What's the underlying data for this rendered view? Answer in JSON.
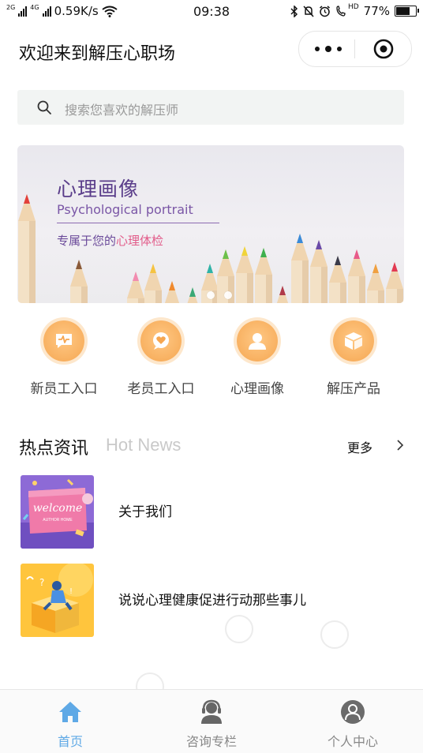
{
  "status_bar": {
    "network_left": "2G",
    "network_right": "4G",
    "speed": "0.59K/s",
    "time": "09:38",
    "hd_label": "HD",
    "battery_percent": "77%",
    "battery_level": 0.77
  },
  "header": {
    "title": "欢迎来到解压心职场"
  },
  "search": {
    "placeholder": "搜索您喜欢的解压师"
  },
  "banner": {
    "title": "心理画像",
    "subtitle": "Psychological portrait",
    "tag_prefix": "专属于您的",
    "tag_highlight": "心理体检",
    "slide_count": 2,
    "active_slide": 1
  },
  "shortcuts": [
    {
      "label": "新员工入口",
      "icon": "pulse-chat-icon"
    },
    {
      "label": "老员工入口",
      "icon": "heart-chat-icon"
    },
    {
      "label": "心理画像",
      "icon": "user-icon"
    },
    {
      "label": "解压产品",
      "icon": "box-icon"
    }
  ],
  "hot_news": {
    "title": "热点资讯",
    "title_en": "Hot News",
    "more_label": "更多",
    "items": [
      {
        "title": "关于我们",
        "thumb_text": "welcome",
        "thumb_subtext": "AUTHOR HOME"
      },
      {
        "title": "说说心理健康促进行动那些事儿"
      }
    ]
  },
  "tabbar": {
    "items": [
      {
        "label": "首页",
        "icon": "home-icon",
        "active": true
      },
      {
        "label": "咨询专栏",
        "icon": "headset-user-icon",
        "active": false
      },
      {
        "label": "个人中心",
        "icon": "person-icon",
        "active": false
      }
    ]
  },
  "colors": {
    "accent_blue": "#5fa9e6",
    "shortcut_orange": "#f9b466",
    "banner_purple": "#5a3d8a",
    "banner_pink": "#e25c8a"
  }
}
